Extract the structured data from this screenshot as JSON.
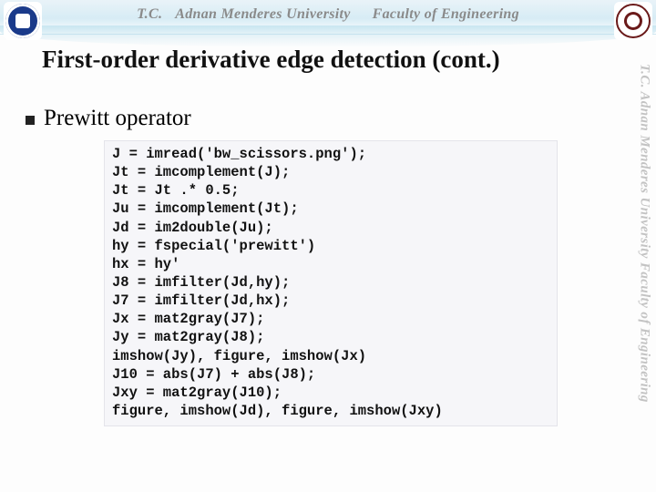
{
  "banner": {
    "tc": "T.C.",
    "univ": "Adnan Menderes University",
    "fac": "Faculty of Engineering"
  },
  "sidewm": "T.C.    Adnan Menderes University    Faculty of Engineering",
  "title": "First-order derivative edge detection (cont.)",
  "bullet": "Prewitt operator",
  "code": [
    "J = imread('bw_scissors.png');",
    "Jt = imcomplement(J);",
    "Jt = Jt .* 0.5;",
    "Ju = imcomplement(Jt);",
    "Jd = im2double(Ju);",
    "hy = fspecial('prewitt')",
    "hx = hy'",
    "J8 = imfilter(Jd,hy);",
    "J7 = imfilter(Jd,hx);",
    "Jx = mat2gray(J7);",
    "Jy = mat2gray(J8);",
    "imshow(Jy), figure, imshow(Jx)",
    "J10 = abs(J7) + abs(J8);",
    "Jxy = mat2gray(J10);",
    "figure, imshow(Jd), figure, imshow(Jxy)"
  ]
}
